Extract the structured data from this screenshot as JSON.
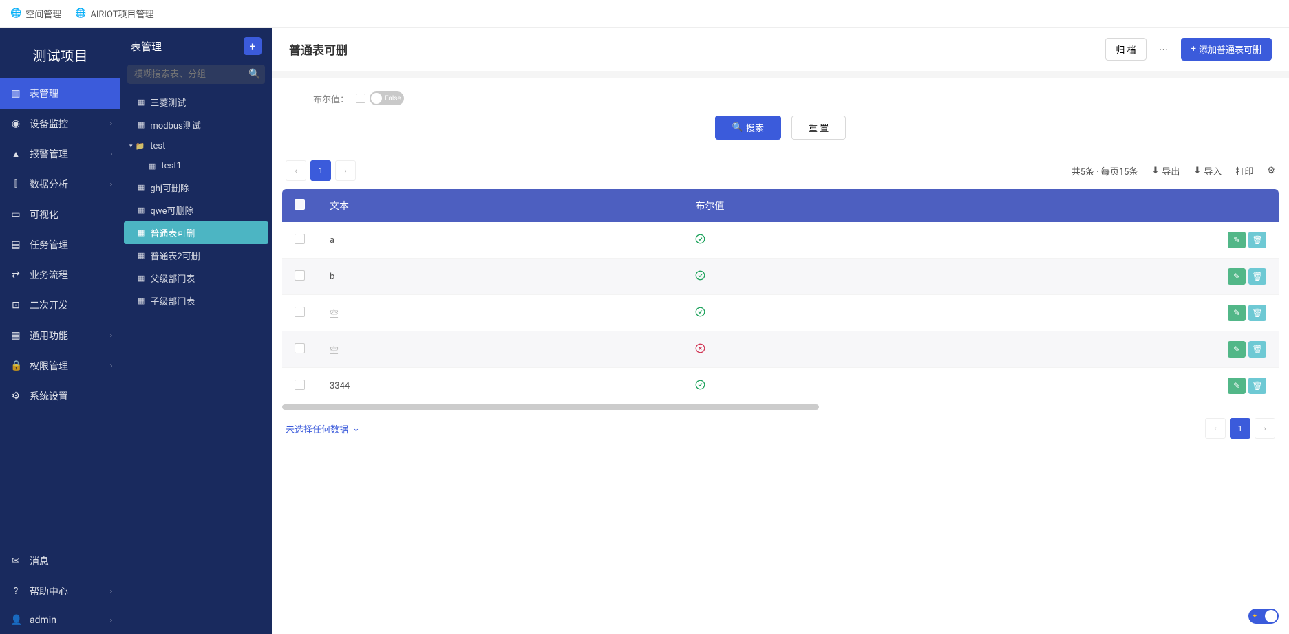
{
  "topbar": {
    "space_mgmt": "空间管理",
    "project_mgmt": "AIRIOT项目管理"
  },
  "project_title": "测试项目",
  "nav": [
    {
      "icon": "chart-bar-icon",
      "label": "表管理",
      "active": true,
      "expandable": false
    },
    {
      "icon": "dashboard-icon",
      "label": "设备监控",
      "expandable": true
    },
    {
      "icon": "alarm-icon",
      "label": "报警管理",
      "expandable": true
    },
    {
      "icon": "analytics-icon",
      "label": "数据分析",
      "expandable": true
    },
    {
      "icon": "display-icon",
      "label": "可视化",
      "expandable": false
    },
    {
      "icon": "task-icon",
      "label": "任务管理",
      "expandable": false
    },
    {
      "icon": "flow-icon",
      "label": "业务流程",
      "expandable": false
    },
    {
      "icon": "dev-icon",
      "label": "二次开发",
      "expandable": false
    },
    {
      "icon": "grid-icon",
      "label": "通用功能",
      "expandable": true
    },
    {
      "icon": "lock-icon",
      "label": "权限管理",
      "expandable": true
    },
    {
      "icon": "settings-icon",
      "label": "系统设置",
      "expandable": false
    }
  ],
  "nav_bottom": [
    {
      "icon": "message-icon",
      "label": "消息"
    },
    {
      "icon": "help-icon",
      "label": "帮助中心",
      "expandable": true
    },
    {
      "icon": "user-icon",
      "label": "admin",
      "expandable": true
    }
  ],
  "panel": {
    "title": "表管理",
    "search_placeholder": "模糊搜索表、分组"
  },
  "tree": [
    {
      "type": "table",
      "label": "三菱测试",
      "indent": 0
    },
    {
      "type": "table",
      "label": "modbus测试",
      "indent": 0
    },
    {
      "type": "folder",
      "label": "test",
      "indent": 0,
      "open": true
    },
    {
      "type": "table",
      "label": "test1",
      "indent": 1
    },
    {
      "type": "table",
      "label": "ghj可删除",
      "indent": 0
    },
    {
      "type": "table",
      "label": "qwe可删除",
      "indent": 0
    },
    {
      "type": "table",
      "label": "普通表可删",
      "indent": 0,
      "active": true
    },
    {
      "type": "table",
      "label": "普通表2可删",
      "indent": 0
    },
    {
      "type": "table",
      "label": "父级部门表",
      "indent": 0
    },
    {
      "type": "table",
      "label": "子级部门表",
      "indent": 0
    }
  ],
  "main": {
    "title": "普通表可删",
    "archive_btn": "归 档",
    "add_btn": "添加普通表可删"
  },
  "filter": {
    "bool_label": "布尔值：",
    "switch_label": "False",
    "search_btn": "搜索",
    "reset_btn": "重 置"
  },
  "toolbar": {
    "page_current": "1",
    "summary": "共5条 · 每页15条",
    "export": "导出",
    "import": "导入",
    "print": "打印"
  },
  "table": {
    "headers": {
      "text": "文本",
      "bool": "布尔值"
    },
    "empty_cell": "空",
    "rows": [
      {
        "text": "a",
        "bool": true
      },
      {
        "text": "b",
        "bool": true
      },
      {
        "text": "",
        "bool": true
      },
      {
        "text": "",
        "bool": false
      },
      {
        "text": "3344",
        "bool": true
      }
    ]
  },
  "footer": {
    "no_selection": "未选择任何数据",
    "page": "1"
  }
}
